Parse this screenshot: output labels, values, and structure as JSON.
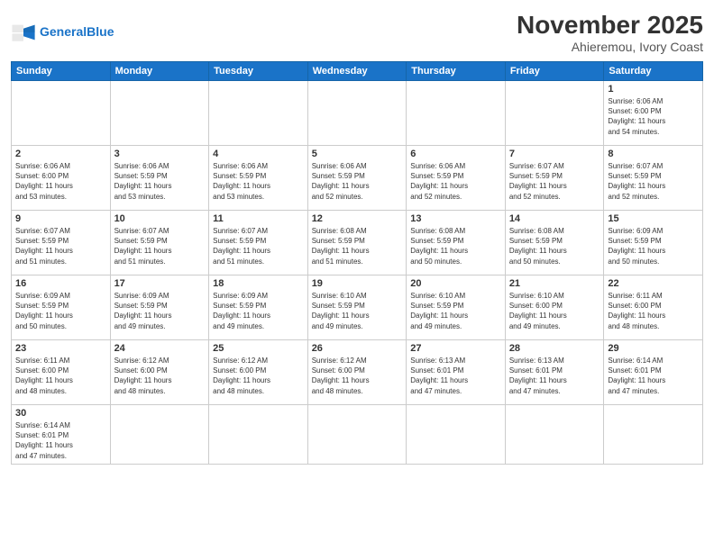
{
  "header": {
    "logo_line1": "General",
    "logo_line2": "Blue",
    "month": "November 2025",
    "location": "Ahieremou, Ivory Coast"
  },
  "weekdays": [
    "Sunday",
    "Monday",
    "Tuesday",
    "Wednesday",
    "Thursday",
    "Friday",
    "Saturday"
  ],
  "weeks": [
    [
      {
        "day": "",
        "info": ""
      },
      {
        "day": "",
        "info": ""
      },
      {
        "day": "",
        "info": ""
      },
      {
        "day": "",
        "info": ""
      },
      {
        "day": "",
        "info": ""
      },
      {
        "day": "",
        "info": ""
      },
      {
        "day": "1",
        "info": "Sunrise: 6:06 AM\nSunset: 6:00 PM\nDaylight: 11 hours\nand 54 minutes."
      }
    ],
    [
      {
        "day": "2",
        "info": "Sunrise: 6:06 AM\nSunset: 6:00 PM\nDaylight: 11 hours\nand 53 minutes."
      },
      {
        "day": "3",
        "info": "Sunrise: 6:06 AM\nSunset: 5:59 PM\nDaylight: 11 hours\nand 53 minutes."
      },
      {
        "day": "4",
        "info": "Sunrise: 6:06 AM\nSunset: 5:59 PM\nDaylight: 11 hours\nand 53 minutes."
      },
      {
        "day": "5",
        "info": "Sunrise: 6:06 AM\nSunset: 5:59 PM\nDaylight: 11 hours\nand 52 minutes."
      },
      {
        "day": "6",
        "info": "Sunrise: 6:06 AM\nSunset: 5:59 PM\nDaylight: 11 hours\nand 52 minutes."
      },
      {
        "day": "7",
        "info": "Sunrise: 6:07 AM\nSunset: 5:59 PM\nDaylight: 11 hours\nand 52 minutes."
      },
      {
        "day": "8",
        "info": "Sunrise: 6:07 AM\nSunset: 5:59 PM\nDaylight: 11 hours\nand 52 minutes."
      }
    ],
    [
      {
        "day": "9",
        "info": "Sunrise: 6:07 AM\nSunset: 5:59 PM\nDaylight: 11 hours\nand 51 minutes."
      },
      {
        "day": "10",
        "info": "Sunrise: 6:07 AM\nSunset: 5:59 PM\nDaylight: 11 hours\nand 51 minutes."
      },
      {
        "day": "11",
        "info": "Sunrise: 6:07 AM\nSunset: 5:59 PM\nDaylight: 11 hours\nand 51 minutes."
      },
      {
        "day": "12",
        "info": "Sunrise: 6:08 AM\nSunset: 5:59 PM\nDaylight: 11 hours\nand 51 minutes."
      },
      {
        "day": "13",
        "info": "Sunrise: 6:08 AM\nSunset: 5:59 PM\nDaylight: 11 hours\nand 50 minutes."
      },
      {
        "day": "14",
        "info": "Sunrise: 6:08 AM\nSunset: 5:59 PM\nDaylight: 11 hours\nand 50 minutes."
      },
      {
        "day": "15",
        "info": "Sunrise: 6:09 AM\nSunset: 5:59 PM\nDaylight: 11 hours\nand 50 minutes."
      }
    ],
    [
      {
        "day": "16",
        "info": "Sunrise: 6:09 AM\nSunset: 5:59 PM\nDaylight: 11 hours\nand 50 minutes."
      },
      {
        "day": "17",
        "info": "Sunrise: 6:09 AM\nSunset: 5:59 PM\nDaylight: 11 hours\nand 49 minutes."
      },
      {
        "day": "18",
        "info": "Sunrise: 6:09 AM\nSunset: 5:59 PM\nDaylight: 11 hours\nand 49 minutes."
      },
      {
        "day": "19",
        "info": "Sunrise: 6:10 AM\nSunset: 5:59 PM\nDaylight: 11 hours\nand 49 minutes."
      },
      {
        "day": "20",
        "info": "Sunrise: 6:10 AM\nSunset: 5:59 PM\nDaylight: 11 hours\nand 49 minutes."
      },
      {
        "day": "21",
        "info": "Sunrise: 6:10 AM\nSunset: 6:00 PM\nDaylight: 11 hours\nand 49 minutes."
      },
      {
        "day": "22",
        "info": "Sunrise: 6:11 AM\nSunset: 6:00 PM\nDaylight: 11 hours\nand 48 minutes."
      }
    ],
    [
      {
        "day": "23",
        "info": "Sunrise: 6:11 AM\nSunset: 6:00 PM\nDaylight: 11 hours\nand 48 minutes."
      },
      {
        "day": "24",
        "info": "Sunrise: 6:12 AM\nSunset: 6:00 PM\nDaylight: 11 hours\nand 48 minutes."
      },
      {
        "day": "25",
        "info": "Sunrise: 6:12 AM\nSunset: 6:00 PM\nDaylight: 11 hours\nand 48 minutes."
      },
      {
        "day": "26",
        "info": "Sunrise: 6:12 AM\nSunset: 6:00 PM\nDaylight: 11 hours\nand 48 minutes."
      },
      {
        "day": "27",
        "info": "Sunrise: 6:13 AM\nSunset: 6:01 PM\nDaylight: 11 hours\nand 47 minutes."
      },
      {
        "day": "28",
        "info": "Sunrise: 6:13 AM\nSunset: 6:01 PM\nDaylight: 11 hours\nand 47 minutes."
      },
      {
        "day": "29",
        "info": "Sunrise: 6:14 AM\nSunset: 6:01 PM\nDaylight: 11 hours\nand 47 minutes."
      }
    ],
    [
      {
        "day": "30",
        "info": "Sunrise: 6:14 AM\nSunset: 6:01 PM\nDaylight: 11 hours\nand 47 minutes."
      },
      {
        "day": "",
        "info": ""
      },
      {
        "day": "",
        "info": ""
      },
      {
        "day": "",
        "info": ""
      },
      {
        "day": "",
        "info": ""
      },
      {
        "day": "",
        "info": ""
      },
      {
        "day": "",
        "info": ""
      }
    ]
  ]
}
